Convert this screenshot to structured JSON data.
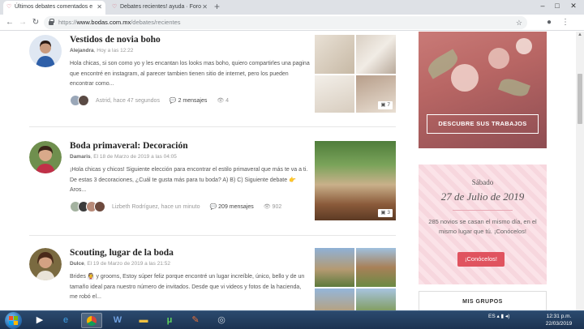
{
  "browser": {
    "tabs": [
      {
        "title": "Últimos debates comentados e",
        "active": true
      },
      {
        "title": "Debates recientes! ayuda · Foro",
        "active": false
      }
    ],
    "url_prefix": "https://",
    "url_host": "www.bodas.com.mx",
    "url_path": "/debates/recientes"
  },
  "posts": [
    {
      "title": "Vestidos de novia boho",
      "author": "Alejandra",
      "date": "Hoy a las 12:22",
      "excerpt": "Hola chicas, si son como yo y les encantan los looks mas boho, quiero compartirles una pagina que encontré en instagram, al parecer tambien tienen sitio de internet, pero los pueden encontrar como...",
      "last_user": "Astrid, hace 47 segundos",
      "messages": "2 mensajes",
      "views": "4",
      "photo_count": "7"
    },
    {
      "title": "Boda primaveral: Decoración",
      "author": "Damaris",
      "date": "El 18 de Marzo de 2019 a las 04:05",
      "excerpt": "¡Hola chicas y chicos! Siguiente elección para encontrar el estilo primaveral que más te va a ti. De estas 3 decoraciones, ¿Cuál te gusta más para tu boda? A) B) C) Siguiente debate 👉 Aros...",
      "last_user": "Lizbeth Rodríguez, hace un minuto",
      "messages": "209 mensajes",
      "views": "902",
      "photo_count": "3"
    },
    {
      "title": "Scouting, lugar de la boda",
      "author": "Dulce",
      "date": "El 19 de Marzo de 2019 a las 21:52",
      "excerpt": "Brides 👰 y grooms, Estoy súper feliz porque encontré un lugar increíble, único, bello y de un tamaño ideal para nuestro número de invitados. Desde que vi videos y fotos de la hacienda, me robó el...",
      "last_user": "",
      "messages": "",
      "views": "",
      "photo_count": ""
    }
  ],
  "sidebar": {
    "discover_label": "DESCUBRE SUS TRABAJOS",
    "day": "Sábado",
    "date": "27 de Julio de 2019",
    "message": "285 novios se casan el mismo día, en el mismo lugar que tú. ¡Conócelos!",
    "button": "¡Conócelos!",
    "groups_title": "MIS GRUPOS"
  },
  "taskbar": {
    "lang": "ES",
    "time": "12:31 p.m.",
    "date": "22/03/2019"
  },
  "colors": {
    "accent": "#d46a7e",
    "button": "#e0535f",
    "taskbar": "#1c3352"
  }
}
